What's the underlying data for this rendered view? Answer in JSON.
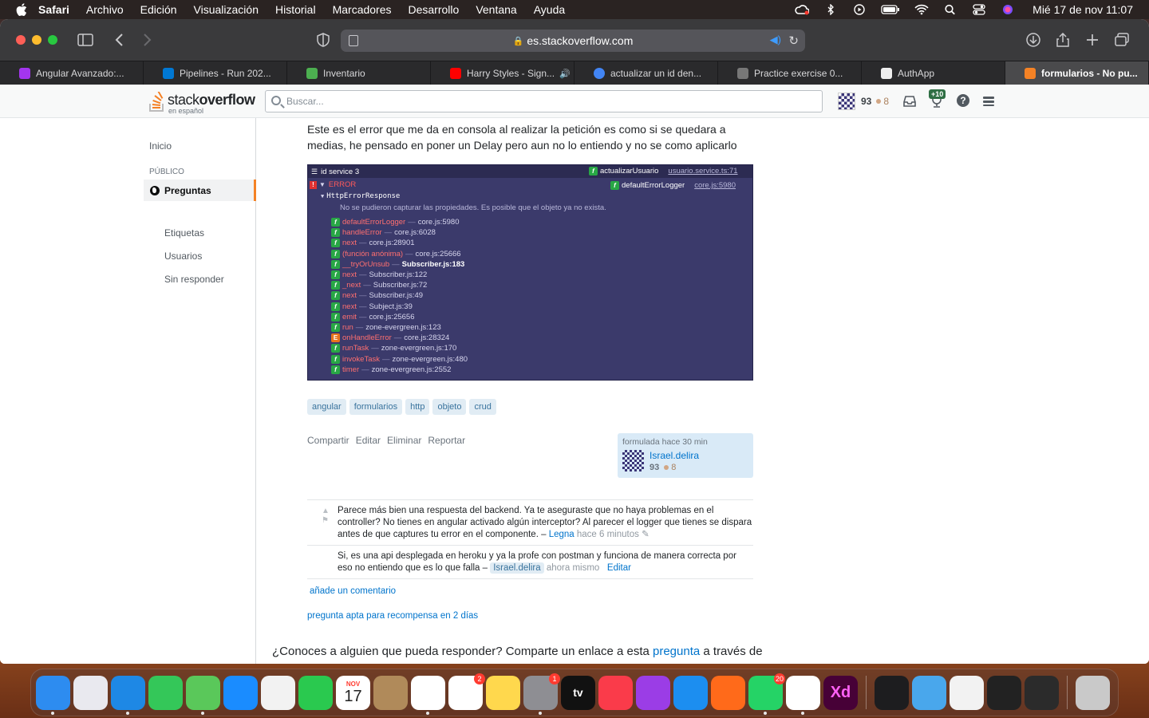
{
  "menubar": {
    "app": "Safari",
    "items": [
      "Archivo",
      "Edición",
      "Visualización",
      "Historial",
      "Marcadores",
      "Desarrollo",
      "Ventana",
      "Ayuda"
    ],
    "clock": "Mié 17 de nov  11:07"
  },
  "browser": {
    "url": "es.stackoverflow.com",
    "tabs": [
      {
        "label": "Angular Avanzado:...",
        "color": "#a335ee"
      },
      {
        "label": "Pipelines - Run 202...",
        "color": "#0078d4"
      },
      {
        "label": "Inventario",
        "color": "#4caf50"
      },
      {
        "label": "Harry Styles - Sign...",
        "color": "#ff0000"
      },
      {
        "label": "actualizar un id den...",
        "color": "#4285f4"
      },
      {
        "label": "Practice exercise 0...",
        "color": "#777777"
      },
      {
        "label": "AuthApp",
        "color": "#111111"
      },
      {
        "label": "formularios - No pu...",
        "color": "#f48225"
      }
    ]
  },
  "so": {
    "logo_a": "stack",
    "logo_b": "overflow",
    "logo_sub": "en español",
    "search_placeholder": "Buscar...",
    "rep": "93",
    "bronze": "8",
    "achievements_badge": "+10",
    "help": "?"
  },
  "nav": {
    "home": "Inicio",
    "public": "PÚBLICO",
    "questions": "Preguntas",
    "tags": "Etiquetas",
    "users": "Usuarios",
    "unanswered": "Sin responder"
  },
  "post": {
    "body": "Este es el error que me da en consola al realizar la petición es como si se quedara a medias, he pensado en poner un Delay pero aun no lo entiendo y no se como aplicarlo",
    "tags": [
      "angular",
      "formularios",
      "http",
      "objeto",
      "crud"
    ],
    "menu": [
      "Compartir",
      "Editar",
      "Eliminar",
      "Reportar"
    ],
    "asked": "formulada hace 30 min",
    "author": "Israel.delira",
    "author_rep": "93",
    "author_bronze": "8",
    "add_comment": "añade un comentario",
    "bounty": "pregunta apta para recompensa en 2 días",
    "share_prefix": "¿Conoces a alguien que pueda responder? Comparte un enlace a esta ",
    "share_link": "pregunta",
    "share_suffix": " a través de"
  },
  "console": {
    "title": "id service 3",
    "top_right_fn": "actualizarUsuario",
    "top_right_loc": "usuario.service.ts:71",
    "error_label": "ERROR",
    "logger_fn": "defaultErrorLogger",
    "logger_loc": "core.js:5980",
    "response": "HttpErrorResponse",
    "message": "No se pudieron capturar las propiedades. Es posible que el objeto ya no exista.",
    "stack": [
      {
        "fn": "defaultErrorLogger",
        "loc": "core.js:5980",
        "kind": "f"
      },
      {
        "fn": "handleError",
        "loc": "core.js:6028",
        "kind": "f"
      },
      {
        "fn": "next",
        "loc": "core.js:28901",
        "kind": "f"
      },
      {
        "fn": "(función anónima)",
        "loc": "core.js:25666",
        "kind": "f"
      },
      {
        "fn": "__tryOrUnsub",
        "loc": "Subscriber.js:183",
        "kind": "f"
      },
      {
        "fn": "next",
        "loc": "Subscriber.js:122",
        "kind": "f"
      },
      {
        "fn": "_next",
        "loc": "Subscriber.js:72",
        "kind": "f"
      },
      {
        "fn": "next",
        "loc": "Subscriber.js:49",
        "kind": "f"
      },
      {
        "fn": "next",
        "loc": "Subject.js:39",
        "kind": "f"
      },
      {
        "fn": "emit",
        "loc": "core.js:25656",
        "kind": "f"
      },
      {
        "fn": "run",
        "loc": "zone-evergreen.js:123",
        "kind": "f"
      },
      {
        "fn": "onHandleError",
        "loc": "core.js:28324",
        "kind": "E"
      },
      {
        "fn": "runTask",
        "loc": "zone-evergreen.js:170",
        "kind": "f"
      },
      {
        "fn": "invokeTask",
        "loc": "zone-evergreen.js:480",
        "kind": "f"
      },
      {
        "fn": "timer",
        "loc": "zone-evergreen.js:2552",
        "kind": "f"
      }
    ]
  },
  "comments": [
    {
      "text": "Parece más bien una respuesta del backend. Ya te aseguraste que no haya problemas en el controller? No tienes en angular activado algún interceptor? Al parecer el logger que tienes se dispara antes de que captures tu error en el componente. –",
      "user": "Legna",
      "time": "hace 6 minutos"
    },
    {
      "text": "Si, es una api desplegada en heroku y ya la profe con postman y funciona de manera correcta por eso no entiendo que es lo que falla –",
      "user": "Israel.delira",
      "time": "ahora mismo",
      "edit": "Editar"
    }
  ],
  "dock": {
    "apps": [
      {
        "name": "finder",
        "color": "#2d8cf0"
      },
      {
        "name": "launchpad",
        "color": "#e9e9ef"
      },
      {
        "name": "safari",
        "color": "#1e88e5"
      },
      {
        "name": "messages",
        "color": "#34c759"
      },
      {
        "name": "maps",
        "color": "#5ac85a"
      },
      {
        "name": "mail",
        "color": "#1a8cff"
      },
      {
        "name": "photos",
        "color": "#f2f2f2"
      },
      {
        "name": "facetime",
        "color": "#2ac94f"
      },
      {
        "name": "calendar",
        "color": "#ffffff"
      },
      {
        "name": "contacts",
        "color": "#b08a5a"
      },
      {
        "name": "vscode",
        "color": "#ffffff"
      },
      {
        "name": "reminders",
        "color": "#ffffff"
      },
      {
        "name": "notes",
        "color": "#ffd84d"
      },
      {
        "name": "system-preferences",
        "color": "#8e8e93"
      },
      {
        "name": "apple-tv",
        "color": "#111111"
      },
      {
        "name": "music",
        "color": "#fa3b4a"
      },
      {
        "name": "podcasts",
        "color": "#9b3de6"
      },
      {
        "name": "app-store",
        "color": "#1c8ef0"
      },
      {
        "name": "pencil-app",
        "color": "#ff6a1a"
      },
      {
        "name": "whatsapp",
        "color": "#25d366"
      },
      {
        "name": "chrome",
        "color": "#ffffff"
      },
      {
        "name": "adobe-xd",
        "color": "#470137"
      },
      {
        "name": "window-vscode",
        "color": "#1d1d1f"
      },
      {
        "name": "downloads-folder",
        "color": "#49a7ec"
      },
      {
        "name": "window-doc",
        "color": "#f2f2f2"
      },
      {
        "name": "window-terminal",
        "color": "#222222"
      },
      {
        "name": "window-whatsapp",
        "color": "#2b2b2b"
      },
      {
        "name": "trash",
        "color": "#c9c9c9"
      }
    ],
    "calendar_month": "NOV",
    "calendar_day": "17",
    "apple_tv_label": "tv",
    "xd_label": "Xd",
    "badge_reminders": "2",
    "badge_sysprefs": "1",
    "badge_whatsapp": "20"
  }
}
